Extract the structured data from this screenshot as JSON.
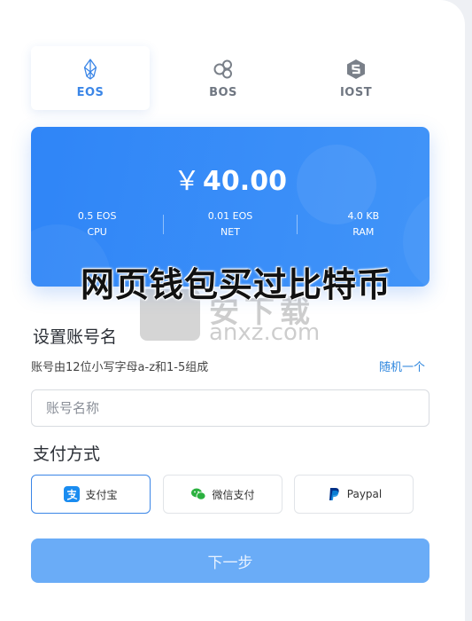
{
  "tabs": [
    {
      "label": "EOS",
      "icon": "eos-icon",
      "active": true
    },
    {
      "label": "BOS",
      "icon": "bos-icon",
      "active": false
    },
    {
      "label": "IOST",
      "icon": "iost-icon",
      "active": false
    }
  ],
  "card": {
    "balance": "40.00",
    "currency_symbol": "￥",
    "stats": [
      {
        "value": "0.5 EOS",
        "label": "CPU"
      },
      {
        "value": "0.01 EOS",
        "label": "NET"
      },
      {
        "value": "4.0 KB",
        "label": "RAM"
      }
    ]
  },
  "overlay": {
    "title": "网页钱包买过比特币",
    "watermark_text": "anxz.com",
    "watermark_cn": "安下载"
  },
  "account": {
    "section_title": "设置账号名",
    "hint": "账号由12位小写字母a-z和1-5组成",
    "random_link": "随机一个",
    "input_placeholder": "账号名称",
    "input_value": ""
  },
  "payment": {
    "section_title": "支付方式",
    "options": [
      {
        "label": "支付宝",
        "icon": "alipay-icon",
        "selected": true
      },
      {
        "label": "微信支付",
        "icon": "wechat-pay-icon",
        "selected": false
      },
      {
        "label": "Paypal",
        "icon": "paypal-icon",
        "selected": false
      }
    ]
  },
  "next_button": "下一步",
  "colors": {
    "accent": "#3b86e7",
    "card_blue": "#3388f7",
    "button_blue": "#6aacf7"
  }
}
